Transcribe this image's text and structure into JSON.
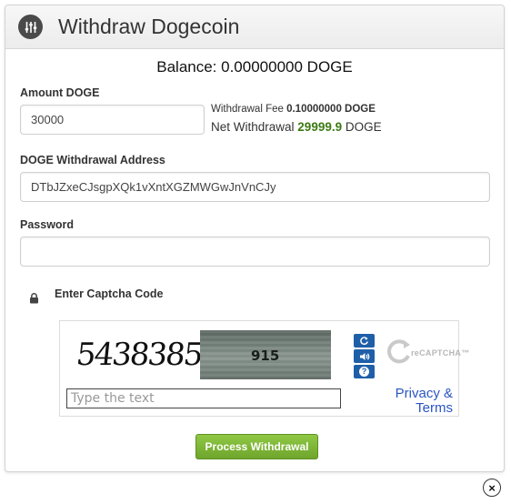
{
  "modal": {
    "title": "Withdraw Dogecoin",
    "icon": "sliders-icon",
    "balance": "Balance: 0.00000000 DOGE"
  },
  "form": {
    "amount": {
      "label": "Amount DOGE",
      "value": "30000"
    },
    "fee": {
      "prefix": "Withdrawal Fee",
      "value": "0.10000000 DOGE"
    },
    "net": {
      "prefix": "Net Withdrawal",
      "amount": "29999.9",
      "suffix": "DOGE",
      "amount_color": "#3c7a12"
    },
    "address": {
      "label": "DOGE Withdrawal Address",
      "value": "DTbJZxeCJsgpXQk1vXntXGZMWGwJnVnCJy"
    },
    "password": {
      "label": "Password",
      "value": ""
    },
    "captcha": {
      "label": "Enter Captcha Code",
      "lock_icon": "lock-icon",
      "image_text_1": "5438385",
      "image_text_2": "915",
      "placeholder": "Type the text",
      "privacy_label": "Privacy & Terms",
      "logo_text": "reCAPTCHA™",
      "buttons": {
        "refresh_icon": "refresh-icon",
        "audio_icon": "audio-icon",
        "help_icon": "help-icon",
        "help_glyph": "?"
      }
    },
    "submit_label": "Process Withdrawal"
  },
  "close_icon": "close-icon",
  "close_glyph": "×",
  "colors": {
    "submit": "#7ab535",
    "link": "#2a55c4",
    "captcha_button": "#1f5fa8"
  }
}
